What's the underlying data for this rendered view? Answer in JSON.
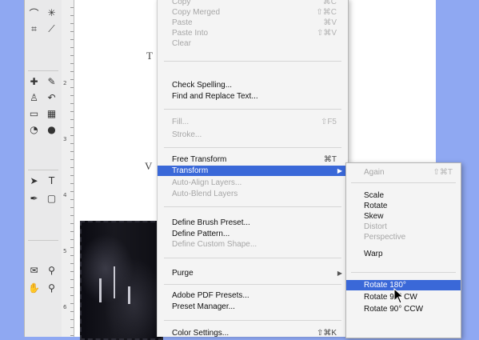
{
  "toolbox": {
    "tools": [
      "lasso-tool",
      "wand-tool",
      "crop-tool",
      "slice-tool",
      "healing-tool",
      "brush-tool",
      "clone-stamp-tool",
      "history-brush-tool",
      "eraser-tool",
      "gradient-tool",
      "blur-tool",
      "dodge-tool",
      "path-selection-tool",
      "type-tool",
      "pen-tool",
      "shape-tool",
      "notes-tool",
      "eyedropper-tool"
    ]
  },
  "ruler": {
    "numbers": [
      "2",
      "3",
      "4",
      "5",
      "6"
    ]
  },
  "canvas": {
    "letters": [
      "T",
      "V"
    ]
  },
  "edit_menu": {
    "items": [
      {
        "label": "Copy",
        "shortcut": "⌘C",
        "disabled": true
      },
      {
        "label": "Copy Merged",
        "shortcut": "⇧⌘C",
        "disabled": true
      },
      {
        "label": "Paste",
        "shortcut": "⌘V",
        "disabled": true
      },
      {
        "label": "Paste Into",
        "shortcut": "⇧⌘V",
        "disabled": true
      },
      {
        "label": "Clear",
        "shortcut": "",
        "disabled": true
      },
      {
        "label": "Check Spelling...",
        "shortcut": "",
        "disabled": false
      },
      {
        "label": "Find and Replace Text...",
        "shortcut": "",
        "disabled": false
      },
      {
        "label": "Fill...",
        "shortcut": "⇧F5",
        "disabled": true
      },
      {
        "label": "Stroke...",
        "shortcut": "",
        "disabled": true
      },
      {
        "label": "Free Transform",
        "shortcut": "⌘T",
        "disabled": false
      },
      {
        "label": "Transform",
        "shortcut": "",
        "disabled": false
      },
      {
        "label": "Auto-Align Layers...",
        "shortcut": "",
        "disabled": true
      },
      {
        "label": "Auto-Blend Layers",
        "shortcut": "",
        "disabled": true
      },
      {
        "label": "Define Brush Preset...",
        "shortcut": "",
        "disabled": false
      },
      {
        "label": "Define Pattern...",
        "shortcut": "",
        "disabled": false
      },
      {
        "label": "Define Custom Shape...",
        "shortcut": "",
        "disabled": true
      },
      {
        "label": "Purge",
        "shortcut": "",
        "disabled": false
      },
      {
        "label": "Adobe PDF Presets...",
        "shortcut": "",
        "disabled": false
      },
      {
        "label": "Preset Manager...",
        "shortcut": "",
        "disabled": false
      },
      {
        "label": "Color Settings...",
        "shortcut": "⇧⌘K",
        "disabled": false
      }
    ]
  },
  "transform_submenu": {
    "items": [
      {
        "label": "Again",
        "shortcut": "⇧⌘T",
        "disabled": true
      },
      {
        "label": "Scale",
        "disabled": false
      },
      {
        "label": "Rotate",
        "disabled": false
      },
      {
        "label": "Skew",
        "disabled": false
      },
      {
        "label": "Distort",
        "disabled": true
      },
      {
        "label": "Perspective",
        "disabled": true
      },
      {
        "label": "Warp",
        "disabled": false
      },
      {
        "label": "Rotate 180°",
        "disabled": false
      },
      {
        "label": "Rotate 90° CW",
        "disabled": false
      },
      {
        "label": "Rotate 90° CCW",
        "disabled": false
      }
    ]
  },
  "colors": {
    "highlight": "#3a68d8",
    "desktop": "#8fa8f2"
  }
}
